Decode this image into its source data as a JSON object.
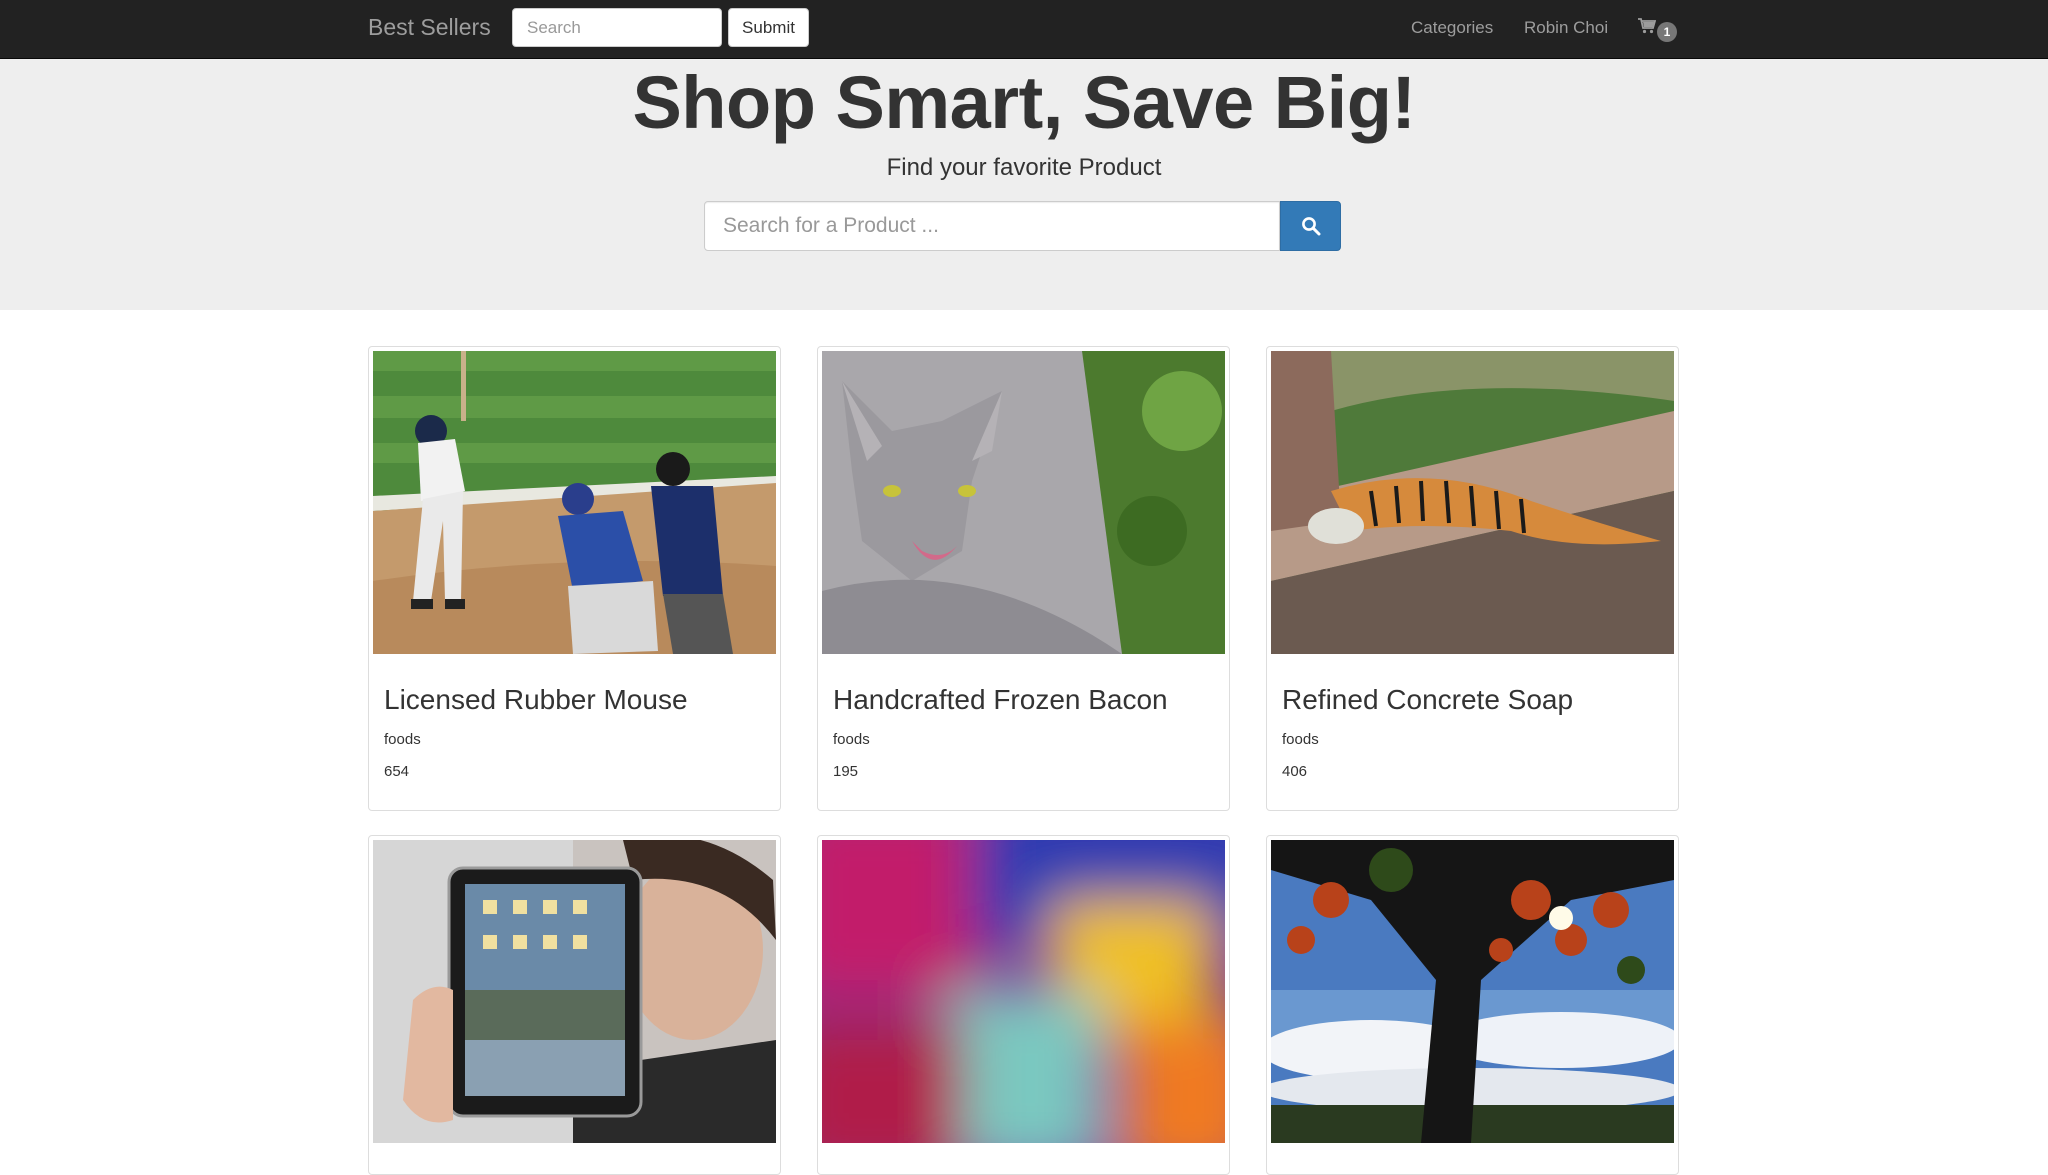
{
  "navbar": {
    "brand": "Best Sellers",
    "search_placeholder": "Search",
    "submit_label": "Submit",
    "categories_label": "Categories",
    "user_name": "Robin Choi",
    "cart_count": "1"
  },
  "hero": {
    "title": "Shop Smart, Save Big!",
    "subtitle": "Find your favorite Product",
    "search_placeholder": "Search for a Product ..."
  },
  "products": [
    {
      "title": "Licensed Rubber Mouse",
      "category": "foods",
      "price": "654",
      "image": "baseball-photo"
    },
    {
      "title": "Handcrafted Frozen Bacon",
      "category": "foods",
      "price": "195",
      "image": "cat-photo"
    },
    {
      "title": "Refined Concrete Soap",
      "category": "foods",
      "price": "406",
      "image": "tiger-photo"
    },
    {
      "title": "",
      "category": "",
      "price": "",
      "image": "tablet-photo"
    },
    {
      "title": "",
      "category": "",
      "price": "",
      "image": "abstract-photo"
    },
    {
      "title": "",
      "category": "",
      "price": "",
      "image": "tree-photo"
    }
  ],
  "colors": {
    "navbar_bg": "#222222",
    "navbar_text": "#9d9d9d",
    "hero_bg": "#eeeeee",
    "primary": "#337ab7"
  }
}
